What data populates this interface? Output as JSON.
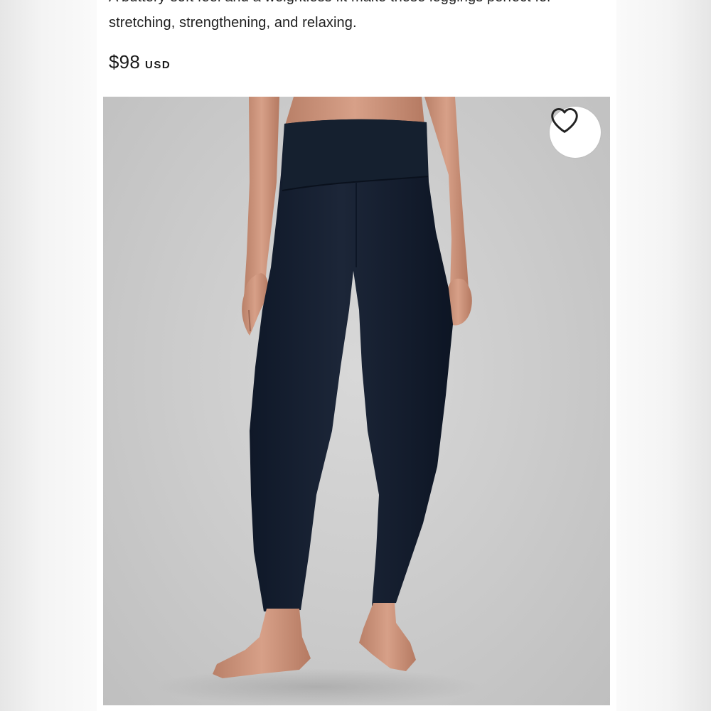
{
  "product": {
    "description_lines": [
      "A buttery-soft feel and a weightless fit make these leggings perfect for",
      "stretching, strengthening, and relaxing."
    ],
    "price": {
      "amount": "$98",
      "currency": "USD"
    },
    "image": {
      "subject": "navy high-rise leggings on model",
      "garment_color": "#182234"
    },
    "wishlist": {
      "icon": "heart-outline-icon"
    }
  }
}
